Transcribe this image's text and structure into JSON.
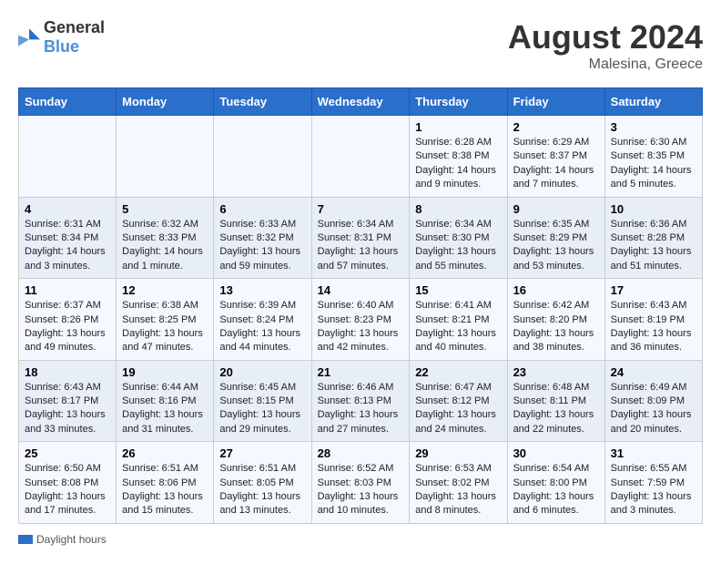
{
  "header": {
    "logo_general": "General",
    "logo_blue": "Blue",
    "month_year": "August 2024",
    "location": "Malesina, Greece"
  },
  "weekdays": [
    "Sunday",
    "Monday",
    "Tuesday",
    "Wednesday",
    "Thursday",
    "Friday",
    "Saturday"
  ],
  "rows": [
    [
      {
        "day": "",
        "info": ""
      },
      {
        "day": "",
        "info": ""
      },
      {
        "day": "",
        "info": ""
      },
      {
        "day": "",
        "info": ""
      },
      {
        "day": "1",
        "info": "Sunrise: 6:28 AM\nSunset: 8:38 PM\nDaylight: 14 hours and 9 minutes."
      },
      {
        "day": "2",
        "info": "Sunrise: 6:29 AM\nSunset: 8:37 PM\nDaylight: 14 hours and 7 minutes."
      },
      {
        "day": "3",
        "info": "Sunrise: 6:30 AM\nSunset: 8:35 PM\nDaylight: 14 hours and 5 minutes."
      }
    ],
    [
      {
        "day": "4",
        "info": "Sunrise: 6:31 AM\nSunset: 8:34 PM\nDaylight: 14 hours and 3 minutes."
      },
      {
        "day": "5",
        "info": "Sunrise: 6:32 AM\nSunset: 8:33 PM\nDaylight: 14 hours and 1 minute."
      },
      {
        "day": "6",
        "info": "Sunrise: 6:33 AM\nSunset: 8:32 PM\nDaylight: 13 hours and 59 minutes."
      },
      {
        "day": "7",
        "info": "Sunrise: 6:34 AM\nSunset: 8:31 PM\nDaylight: 13 hours and 57 minutes."
      },
      {
        "day": "8",
        "info": "Sunrise: 6:34 AM\nSunset: 8:30 PM\nDaylight: 13 hours and 55 minutes."
      },
      {
        "day": "9",
        "info": "Sunrise: 6:35 AM\nSunset: 8:29 PM\nDaylight: 13 hours and 53 minutes."
      },
      {
        "day": "10",
        "info": "Sunrise: 6:36 AM\nSunset: 8:28 PM\nDaylight: 13 hours and 51 minutes."
      }
    ],
    [
      {
        "day": "11",
        "info": "Sunrise: 6:37 AM\nSunset: 8:26 PM\nDaylight: 13 hours and 49 minutes."
      },
      {
        "day": "12",
        "info": "Sunrise: 6:38 AM\nSunset: 8:25 PM\nDaylight: 13 hours and 47 minutes."
      },
      {
        "day": "13",
        "info": "Sunrise: 6:39 AM\nSunset: 8:24 PM\nDaylight: 13 hours and 44 minutes."
      },
      {
        "day": "14",
        "info": "Sunrise: 6:40 AM\nSunset: 8:23 PM\nDaylight: 13 hours and 42 minutes."
      },
      {
        "day": "15",
        "info": "Sunrise: 6:41 AM\nSunset: 8:21 PM\nDaylight: 13 hours and 40 minutes."
      },
      {
        "day": "16",
        "info": "Sunrise: 6:42 AM\nSunset: 8:20 PM\nDaylight: 13 hours and 38 minutes."
      },
      {
        "day": "17",
        "info": "Sunrise: 6:43 AM\nSunset: 8:19 PM\nDaylight: 13 hours and 36 minutes."
      }
    ],
    [
      {
        "day": "18",
        "info": "Sunrise: 6:43 AM\nSunset: 8:17 PM\nDaylight: 13 hours and 33 minutes."
      },
      {
        "day": "19",
        "info": "Sunrise: 6:44 AM\nSunset: 8:16 PM\nDaylight: 13 hours and 31 minutes."
      },
      {
        "day": "20",
        "info": "Sunrise: 6:45 AM\nSunset: 8:15 PM\nDaylight: 13 hours and 29 minutes."
      },
      {
        "day": "21",
        "info": "Sunrise: 6:46 AM\nSunset: 8:13 PM\nDaylight: 13 hours and 27 minutes."
      },
      {
        "day": "22",
        "info": "Sunrise: 6:47 AM\nSunset: 8:12 PM\nDaylight: 13 hours and 24 minutes."
      },
      {
        "day": "23",
        "info": "Sunrise: 6:48 AM\nSunset: 8:11 PM\nDaylight: 13 hours and 22 minutes."
      },
      {
        "day": "24",
        "info": "Sunrise: 6:49 AM\nSunset: 8:09 PM\nDaylight: 13 hours and 20 minutes."
      }
    ],
    [
      {
        "day": "25",
        "info": "Sunrise: 6:50 AM\nSunset: 8:08 PM\nDaylight: 13 hours and 17 minutes."
      },
      {
        "day": "26",
        "info": "Sunrise: 6:51 AM\nSunset: 8:06 PM\nDaylight: 13 hours and 15 minutes."
      },
      {
        "day": "27",
        "info": "Sunrise: 6:51 AM\nSunset: 8:05 PM\nDaylight: 13 hours and 13 minutes."
      },
      {
        "day": "28",
        "info": "Sunrise: 6:52 AM\nSunset: 8:03 PM\nDaylight: 13 hours and 10 minutes."
      },
      {
        "day": "29",
        "info": "Sunrise: 6:53 AM\nSunset: 8:02 PM\nDaylight: 13 hours and 8 minutes."
      },
      {
        "day": "30",
        "info": "Sunrise: 6:54 AM\nSunset: 8:00 PM\nDaylight: 13 hours and 6 minutes."
      },
      {
        "day": "31",
        "info": "Sunrise: 6:55 AM\nSunset: 7:59 PM\nDaylight: 13 hours and 3 minutes."
      }
    ]
  ],
  "footer": {
    "legend_label": "Daylight hours"
  }
}
